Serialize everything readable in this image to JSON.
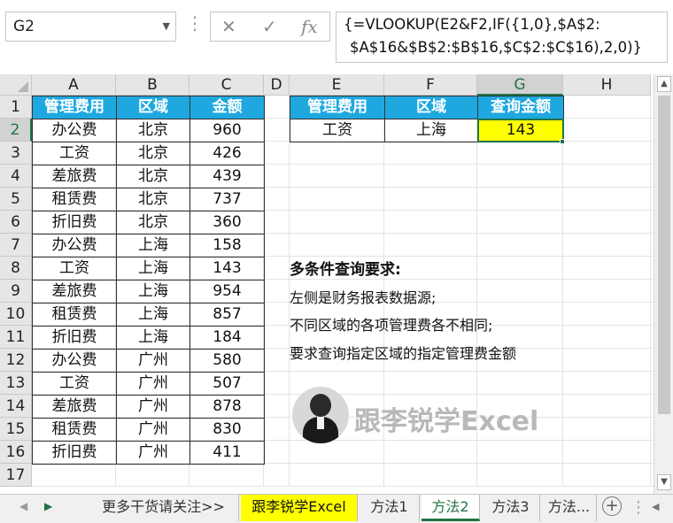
{
  "name_box": {
    "value": "G2"
  },
  "formula_bar": {
    "line1": "{=VLOOKUP(E2&F2,IF({1,0},$A$2:",
    "line2": "$A$16&$B$2:$B$16,$C$2:$C$16),2,0)}",
    "cancel_glyph": "✕",
    "enter_glyph": "✓",
    "fx_glyph": "fx"
  },
  "columns": [
    "A",
    "B",
    "C",
    "D",
    "E",
    "F",
    "G",
    "H"
  ],
  "rows": [
    "1",
    "2",
    "3",
    "4",
    "5",
    "6",
    "7",
    "8",
    "9",
    "10",
    "11",
    "12",
    "13",
    "14",
    "15",
    "16",
    "17"
  ],
  "source_table": {
    "headers": [
      "管理费用",
      "区域",
      "金额"
    ],
    "rows": [
      [
        "办公费",
        "北京",
        "960"
      ],
      [
        "工资",
        "北京",
        "426"
      ],
      [
        "差旅费",
        "北京",
        "439"
      ],
      [
        "租赁费",
        "北京",
        "737"
      ],
      [
        "折旧费",
        "北京",
        "360"
      ],
      [
        "办公费",
        "上海",
        "158"
      ],
      [
        "工资",
        "上海",
        "143"
      ],
      [
        "差旅费",
        "上海",
        "954"
      ],
      [
        "租赁费",
        "上海",
        "857"
      ],
      [
        "折旧费",
        "上海",
        "184"
      ],
      [
        "办公费",
        "广州",
        "580"
      ],
      [
        "工资",
        "广州",
        "507"
      ],
      [
        "差旅费",
        "广州",
        "878"
      ],
      [
        "租赁费",
        "广州",
        "830"
      ],
      [
        "折旧费",
        "广州",
        "411"
      ]
    ]
  },
  "lookup_table": {
    "headers": [
      "管理费用",
      "区域",
      "查询金额"
    ],
    "row": [
      "工资",
      "上海",
      "143"
    ]
  },
  "notes": {
    "title": "多条件查询要求:",
    "line1": "左侧是财务报表数据源;",
    "line2": "不同区域的各项管理费各不相同;",
    "line3": "要求查询指定区域的指定管理费金额"
  },
  "watermark": {
    "text": "跟李锐学Excel"
  },
  "sheet_tabs": [
    "更多干货请关注>>",
    "跟李锐学Excel",
    "方法1",
    "方法2",
    "方法3",
    "方法..."
  ],
  "active_tab": "方法2",
  "colors": {
    "header_blue": "#1fa8e0",
    "highlight_yellow": "#ffff00",
    "excel_green": "#217346"
  }
}
